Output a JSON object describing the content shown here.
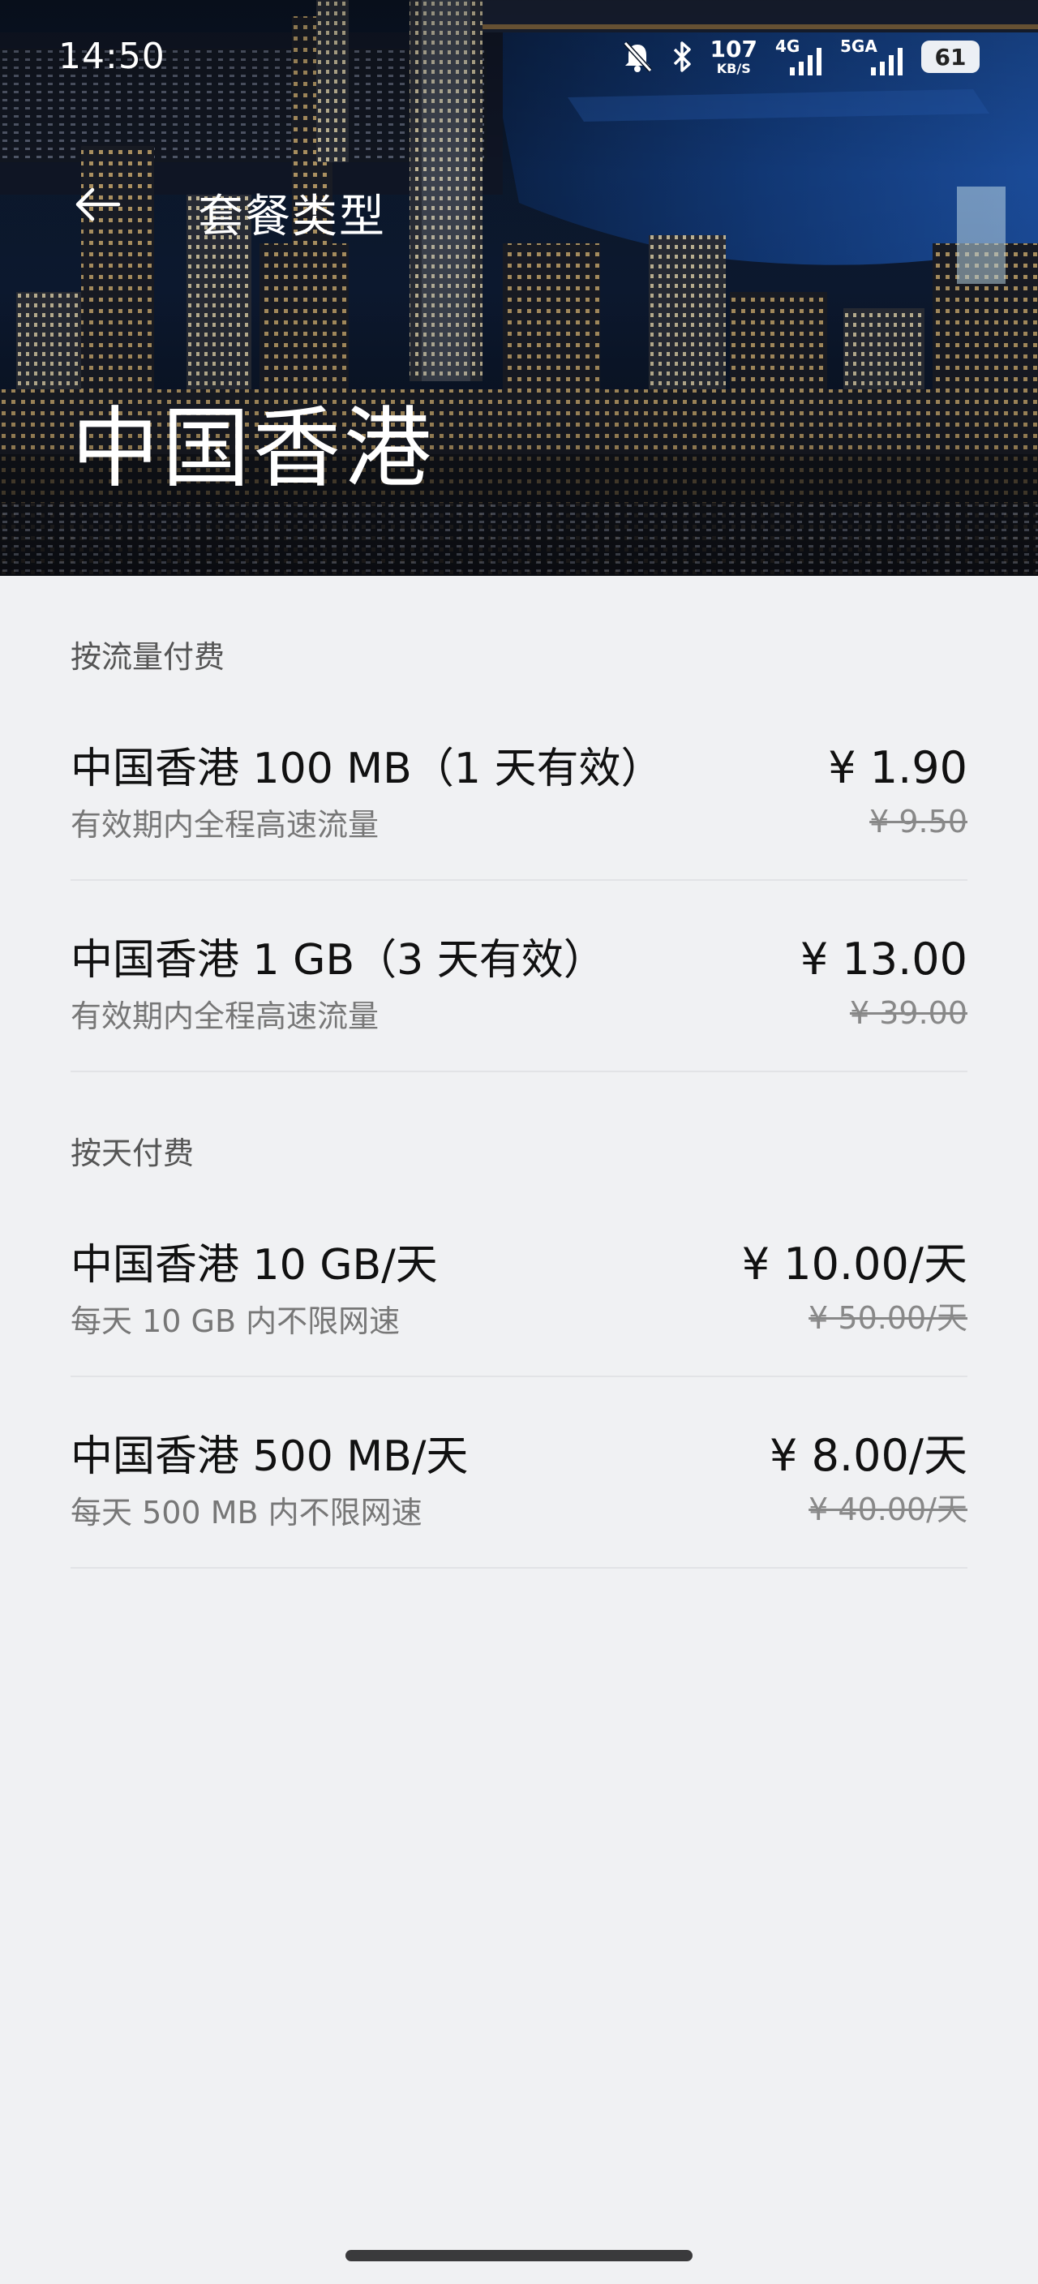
{
  "status_bar": {
    "time": "14:50",
    "net_speed_value": "107",
    "net_speed_unit": "KB/S",
    "sim1_tag": "4G",
    "sim2_tag": "5GA",
    "battery": "61",
    "icons": [
      "mute-icon",
      "bluetooth-icon",
      "signal-icon",
      "signal-icon",
      "battery-icon"
    ]
  },
  "header": {
    "back_icon": "arrow-left-icon",
    "title": "套餐类型",
    "region": "中国香港"
  },
  "sections": [
    {
      "title": "按流量付费",
      "plans": [
        {
          "name": "中国香港 100 MB（1 天有效）",
          "desc": "有效期内全程高速流量",
          "price": "¥ 1.90",
          "original_price": "¥ 9.50"
        },
        {
          "name": "中国香港 1 GB（3 天有效）",
          "desc": "有效期内全程高速流量",
          "price": "¥ 13.00",
          "original_price": "¥ 39.00"
        }
      ]
    },
    {
      "title": "按天付费",
      "plans": [
        {
          "name": "中国香港 10 GB/天",
          "desc": "每天 10 GB 内不限网速",
          "price": "¥ 10.00/天",
          "original_price": "¥ 50.00/天"
        },
        {
          "name": "中国香港 500 MB/天",
          "desc": "每天 500 MB 内不限网速",
          "price": "¥ 8.00/天",
          "original_price": "¥ 40.00/天"
        }
      ]
    }
  ],
  "colors": {
    "page_background": "#f0f1f3",
    "divider": "#e2e3e6",
    "primary_text": "#111111",
    "secondary_text": "#777777"
  }
}
